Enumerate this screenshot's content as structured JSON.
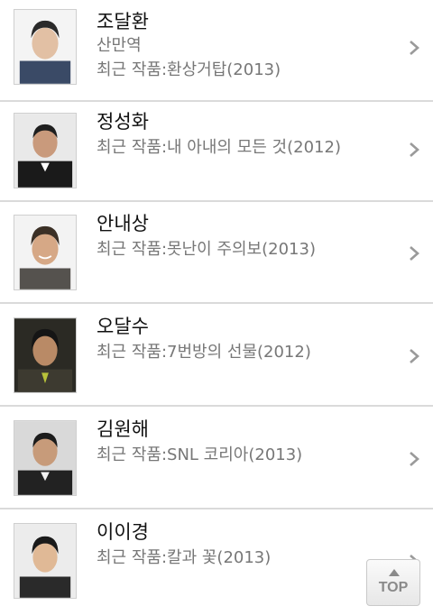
{
  "actors": [
    {
      "name": "조달환",
      "role": "산만역",
      "work": "최근 작품:환상거탑(2013)",
      "photo": "actor-photo"
    },
    {
      "name": "정성화",
      "work": "최근 작품:내 아내의 모든 것(2012)",
      "photo": "actor-photo"
    },
    {
      "name": "안내상",
      "work": "최근 작품:못난이 주의보(2013)",
      "photo": "actor-photo"
    },
    {
      "name": "오달수",
      "work": "최근 작품:7번방의 선물(2012)",
      "photo": "actor-photo"
    },
    {
      "name": "김원해",
      "work": "최근 작품:SNL 코리아(2013)",
      "photo": "actor-photo"
    },
    {
      "name": "이이경",
      "work": "최근 작품:칼과 꽃(2013)",
      "photo": "actor-photo"
    }
  ],
  "top_button": {
    "label": "TOP",
    "icon": "arrow-up-icon"
  },
  "colors": {
    "name": "#111111",
    "secondary": "#777777",
    "divider": "#dadada",
    "chevron": "#9a9a9a"
  }
}
